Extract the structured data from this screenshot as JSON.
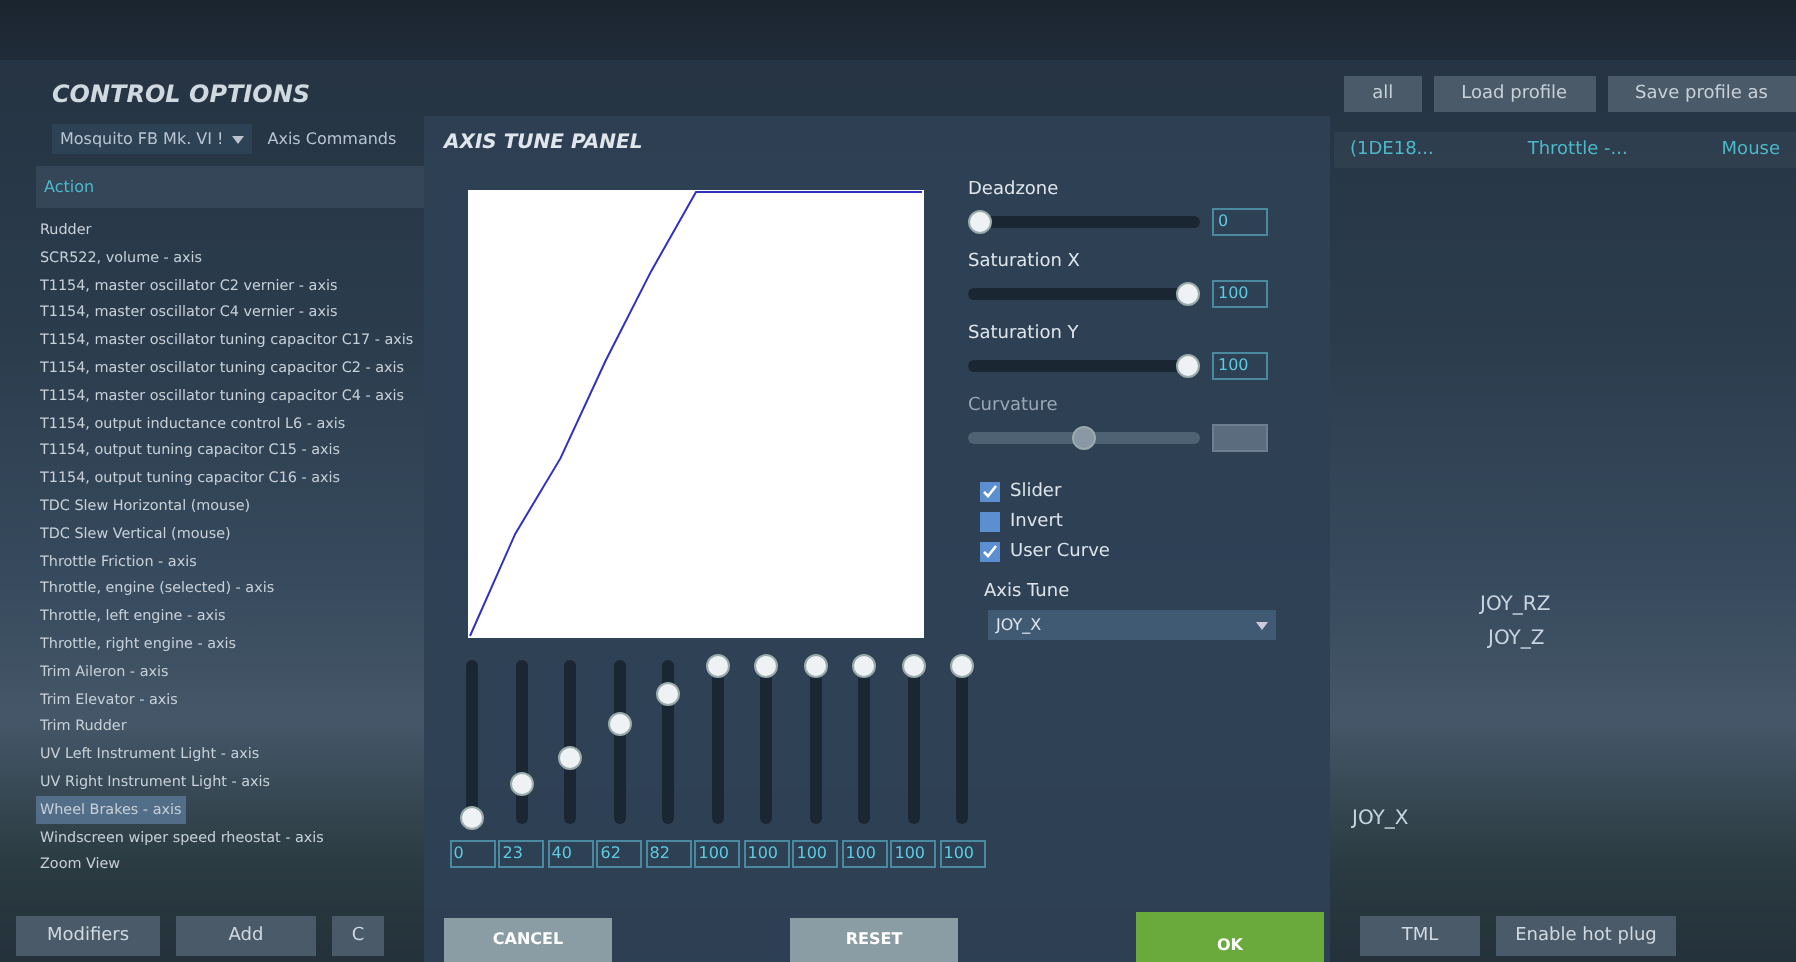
{
  "controls": {
    "title": "CONTROL OPTIONS",
    "aircraft": "Mosquito FB Mk. VI !",
    "category": "Axis Commands",
    "column_header": "Action",
    "actions": [
      {
        "label": "Rudder",
        "selected": false
      },
      {
        "label": "SCR522, volume - axis",
        "selected": false
      },
      {
        "label": "T1154, master oscillator C2 vernier - axis",
        "selected": false
      },
      {
        "label": "T1154, master oscillator C4 vernier - axis",
        "selected": false
      },
      {
        "label": "T1154, master oscillator tuning capacitor C17 - axis",
        "selected": false
      },
      {
        "label": "T1154, master oscillator tuning capacitor C2 - axis",
        "selected": false
      },
      {
        "label": "T1154, master oscillator tuning capacitor C4 - axis",
        "selected": false
      },
      {
        "label": "T1154, output inductance control L6 - axis",
        "selected": false
      },
      {
        "label": "T1154, output tuning capacitor C15 - axis",
        "selected": false
      },
      {
        "label": "T1154, output tuning capacitor C16 - axis",
        "selected": false
      },
      {
        "label": "TDC Slew Horizontal (mouse)",
        "selected": false
      },
      {
        "label": "TDC Slew Vertical (mouse)",
        "selected": false
      },
      {
        "label": "Throttle Friction - axis",
        "selected": false
      },
      {
        "label": "Throttle, engine (selected) - axis",
        "selected": false
      },
      {
        "label": "Throttle, left engine - axis",
        "selected": false
      },
      {
        "label": "Throttle, right engine - axis",
        "selected": false
      },
      {
        "label": "Trim Aileron - axis",
        "selected": false
      },
      {
        "label": "Trim Elevator - axis",
        "selected": false
      },
      {
        "label": "Trim Rudder",
        "selected": false
      },
      {
        "label": "UV Left Instrument Light - axis",
        "selected": false
      },
      {
        "label": "UV Right Instrument Light - axis",
        "selected": false
      },
      {
        "label": "Wheel Brakes - axis",
        "selected": true
      },
      {
        "label": "Windscreen wiper speed rheostat - axis",
        "selected": false
      },
      {
        "label": "Zoom View",
        "selected": false
      }
    ],
    "top_buttons": [
      "all",
      "Load profile",
      "Save profile as"
    ],
    "devices": [
      "(1DE18...",
      "Throttle -...",
      "Mouse"
    ],
    "bindings": [
      "JOY_RZ",
      "JOY_Z",
      "JOY_X"
    ],
    "bottom_buttons": [
      "Modifiers",
      "Add",
      "C",
      "TML",
      "Enable hot plug"
    ]
  },
  "axis_tune": {
    "title": "AXIS TUNE PANEL",
    "settings": [
      {
        "label": "Deadzone",
        "level": 0,
        "value": "0",
        "disabled": false
      },
      {
        "label": "Saturation X",
        "level": 1,
        "value": "100",
        "disabled": false
      },
      {
        "label": "Saturation Y",
        "level": 1,
        "value": "100",
        "disabled": false
      },
      {
        "label": "Curvature",
        "level": 0.5,
        "disabled": true
      }
    ],
    "options": [
      {
        "label": "Slider",
        "checked": true
      },
      {
        "label": "Invert",
        "checked": false
      },
      {
        "label": "User Curve",
        "checked": true
      }
    ],
    "axis_label": "Axis Tune",
    "axis_value": "JOY_X",
    "curve": [
      {
        "value": "0",
        "level": 0
      },
      {
        "value": "23",
        "level": 0.23
      },
      {
        "value": "40",
        "level": 0.4
      },
      {
        "value": "62",
        "level": 0.62
      },
      {
        "value": "82",
        "level": 0.82
      },
      {
        "value": "100",
        "level": 1
      },
      {
        "value": "100",
        "level": 1
      },
      {
        "value": "100",
        "level": 1
      },
      {
        "value": "100",
        "level": 1
      },
      {
        "value": "100",
        "level": 1
      },
      {
        "value": "100",
        "level": 1
      }
    ],
    "buttons": [
      {
        "label": "CANCEL",
        "kind": "plain"
      },
      {
        "label": "RESET",
        "kind": "plain"
      },
      {
        "label": "OK",
        "kind": "primary"
      }
    ]
  }
}
